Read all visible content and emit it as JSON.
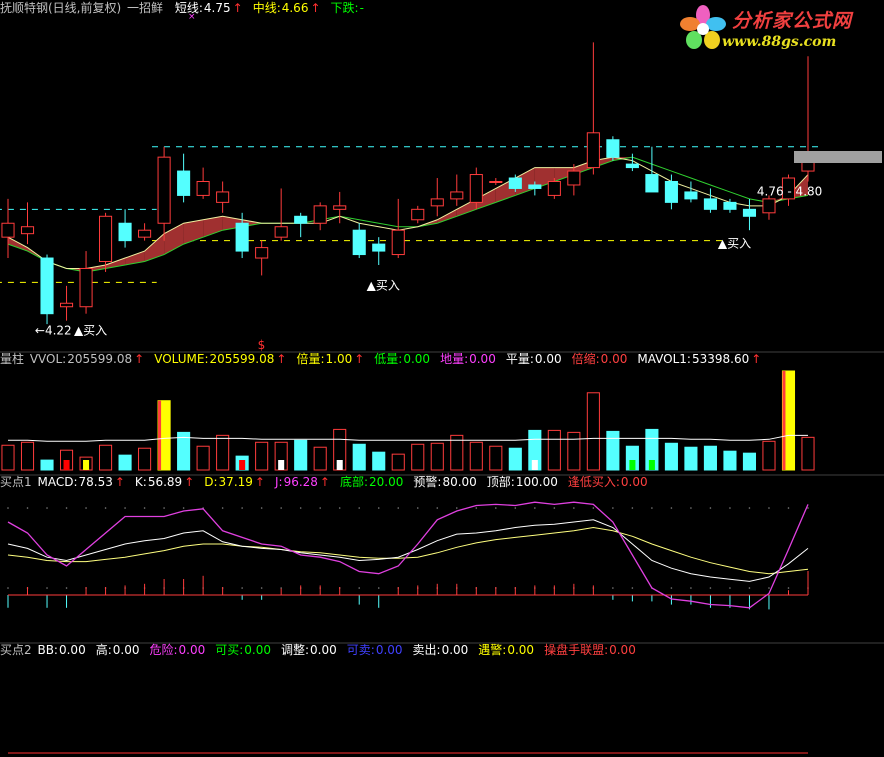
{
  "header": {
    "title": "抚顺特钢(日线,前复权)",
    "indicator_name": "一招鲜",
    "items": [
      {
        "label": "短线:",
        "value": "4.75",
        "color": "#ffffff"
      },
      {
        "label": "中线:",
        "value": "4.66",
        "color": "#ffff00"
      },
      {
        "label": "下跌:",
        "value": "-",
        "color": "#00ff00"
      }
    ],
    "marker": "×"
  },
  "logo": {
    "cn": "分析家公式网",
    "url": "www.88gs.com"
  },
  "volume_header": {
    "name": "量柱",
    "items": [
      {
        "label": "VVOL:",
        "value": "205599.08",
        "color": "#c0c0c0",
        "arrow": true
      },
      {
        "label": "VOLUME:",
        "value": "205599.08",
        "color": "#ffff00",
        "arrow": true
      },
      {
        "label": "倍量:",
        "value": "1.00",
        "color": "#ffff00",
        "arrow": true
      },
      {
        "label": "低量:",
        "value": "0.00",
        "color": "#00ff00",
        "arrow": false
      },
      {
        "label": "地量:",
        "value": "0.00",
        "color": "#ff40ff",
        "arrow": false
      },
      {
        "label": "平量:",
        "value": "0.00",
        "color": "#ffffff",
        "arrow": false
      },
      {
        "label": "倍缩:",
        "value": "0.00",
        "color": "#ff4040",
        "arrow": false
      },
      {
        "label": "MAVOL1:",
        "value": "53398.60",
        "color": "#ffffff",
        "arrow": true
      }
    ]
  },
  "macd_header": {
    "name": "买点1",
    "items": [
      {
        "label": "MACD:",
        "value": "78.53",
        "color": "#ffffff",
        "arrow": true
      },
      {
        "label": "K:",
        "value": "56.89",
        "color": "#ffffff",
        "arrow": true
      },
      {
        "label": "D:",
        "value": "37.19",
        "color": "#ffff00",
        "arrow": true
      },
      {
        "label": "J:",
        "value": "96.28",
        "color": "#ff40ff",
        "arrow": true
      },
      {
        "label": "底部:",
        "value": "20.00",
        "color": "#00ff00",
        "arrow": false
      },
      {
        "label": "预警:",
        "value": "80.00",
        "color": "#ffffff",
        "arrow": false
      },
      {
        "label": "顶部:",
        "value": "100.00",
        "color": "#ffffff",
        "arrow": false
      },
      {
        "label": "逢低买入:",
        "value": "0.00",
        "color": "#ff4040",
        "arrow": false
      }
    ]
  },
  "bb_header": {
    "name": "买点2",
    "items": [
      {
        "label": "BB:",
        "value": "0.00",
        "color": "#ffffff"
      },
      {
        "label": "高:",
        "value": "0.00",
        "color": "#ffffff"
      },
      {
        "label": "危险:",
        "value": "0.00",
        "color": "#ff40ff"
      },
      {
        "label": "可买:",
        "value": "0.00",
        "color": "#00ff00"
      },
      {
        "label": "调整:",
        "value": "0.00",
        "color": "#ffffff"
      },
      {
        "label": "可卖:",
        "value": "0.00",
        "color": "#4040ff"
      },
      {
        "label": "卖出:",
        "value": "0.00",
        "color": "#ffffff"
      },
      {
        "label": "遇警:",
        "value": "0.00",
        "color": "#ffff00"
      },
      {
        "label": "操盘手联盟:",
        "value": "0.00",
        "color": "#ff4040"
      }
    ]
  },
  "chart_data": {
    "type": "candlestick",
    "price_range": [
      4.15,
      5.09
    ],
    "candles": [
      {
        "o": 4.46,
        "h": 4.57,
        "l": 4.4,
        "c": 4.5
      },
      {
        "o": 4.47,
        "h": 4.56,
        "l": 4.44,
        "c": 4.49
      },
      {
        "o": 4.4,
        "h": 4.41,
        "l": 4.21,
        "c": 4.24
      },
      {
        "o": 4.26,
        "h": 4.32,
        "l": 4.22,
        "c": 4.27
      },
      {
        "o": 4.26,
        "h": 4.42,
        "l": 4.24,
        "c": 4.37
      },
      {
        "o": 4.39,
        "h": 4.53,
        "l": 4.36,
        "c": 4.52
      },
      {
        "o": 4.5,
        "h": 4.54,
        "l": 4.43,
        "c": 4.45
      },
      {
        "o": 4.46,
        "h": 4.5,
        "l": 4.45,
        "c": 4.48
      },
      {
        "o": 4.5,
        "h": 4.72,
        "l": 4.45,
        "c": 4.69
      },
      {
        "o": 4.65,
        "h": 4.7,
        "l": 4.56,
        "c": 4.58
      },
      {
        "o": 4.58,
        "h": 4.66,
        "l": 4.57,
        "c": 4.62
      },
      {
        "o": 4.56,
        "h": 4.62,
        "l": 4.53,
        "c": 4.59
      },
      {
        "o": 4.5,
        "h": 4.53,
        "l": 4.4,
        "c": 4.42
      },
      {
        "o": 4.4,
        "h": 4.45,
        "l": 4.35,
        "c": 4.43
      },
      {
        "o": 4.46,
        "h": 4.6,
        "l": 4.45,
        "c": 4.49
      },
      {
        "o": 4.52,
        "h": 4.53,
        "l": 4.46,
        "c": 4.5
      },
      {
        "o": 4.5,
        "h": 4.56,
        "l": 4.48,
        "c": 4.55
      },
      {
        "o": 4.54,
        "h": 4.59,
        "l": 4.5,
        "c": 4.55
      },
      {
        "o": 4.48,
        "h": 4.5,
        "l": 4.4,
        "c": 4.41
      },
      {
        "o": 4.44,
        "h": 4.46,
        "l": 4.38,
        "c": 4.42
      },
      {
        "o": 4.41,
        "h": 4.57,
        "l": 4.4,
        "c": 4.48
      },
      {
        "o": 4.51,
        "h": 4.55,
        "l": 4.5,
        "c": 4.54
      },
      {
        "o": 4.55,
        "h": 4.63,
        "l": 4.52,
        "c": 4.57
      },
      {
        "o": 4.57,
        "h": 4.64,
        "l": 4.55,
        "c": 4.59
      },
      {
        "o": 4.56,
        "h": 4.66,
        "l": 4.54,
        "c": 4.64
      },
      {
        "o": 4.62,
        "h": 4.63,
        "l": 4.61,
        "c": 4.62
      },
      {
        "o": 4.63,
        "h": 4.64,
        "l": 4.59,
        "c": 4.6
      },
      {
        "o": 4.61,
        "h": 4.62,
        "l": 4.58,
        "c": 4.6
      },
      {
        "o": 4.58,
        "h": 4.63,
        "l": 4.57,
        "c": 4.62
      },
      {
        "o": 4.61,
        "h": 4.67,
        "l": 4.58,
        "c": 4.65
      },
      {
        "o": 4.66,
        "h": 5.02,
        "l": 4.64,
        "c": 4.76
      },
      {
        "o": 4.74,
        "h": 4.75,
        "l": 4.68,
        "c": 4.69
      },
      {
        "o": 4.67,
        "h": 4.7,
        "l": 4.65,
        "c": 4.66
      },
      {
        "o": 4.64,
        "h": 4.72,
        "l": 4.6,
        "c": 4.59
      },
      {
        "o": 4.62,
        "h": 4.64,
        "l": 4.54,
        "c": 4.56
      },
      {
        "o": 4.59,
        "h": 4.62,
        "l": 4.56,
        "c": 4.57
      },
      {
        "o": 4.57,
        "h": 4.6,
        "l": 4.53,
        "c": 4.54
      },
      {
        "o": 4.56,
        "h": 4.57,
        "l": 4.53,
        "c": 4.54
      },
      {
        "o": 4.54,
        "h": 4.57,
        "l": 4.48,
        "c": 4.52
      },
      {
        "o": 4.53,
        "h": 4.58,
        "l": 4.51,
        "c": 4.57
      },
      {
        "o": 4.57,
        "h": 4.64,
        "l": 4.55,
        "c": 4.63
      },
      {
        "o": 4.65,
        "h": 4.98,
        "l": 4.62,
        "c": 4.68
      }
    ],
    "ma_short": [
      4.46,
      4.43,
      4.39,
      4.37,
      4.37,
      4.38,
      4.4,
      4.42,
      4.47,
      4.5,
      4.51,
      4.52,
      4.51,
      4.5,
      4.5,
      4.5,
      4.5,
      4.52,
      4.5,
      4.49,
      4.48,
      4.49,
      4.51,
      4.54,
      4.57,
      4.6,
      4.63,
      4.66,
      4.66,
      4.66,
      4.68,
      4.69,
      4.68,
      4.65,
      4.62,
      4.6,
      4.58,
      4.56,
      4.55,
      4.55,
      4.58,
      4.64
    ],
    "ma_mid": [
      4.44,
      4.42,
      4.39,
      4.37,
      4.36,
      4.37,
      4.38,
      4.39,
      4.41,
      4.44,
      4.46,
      4.48,
      4.49,
      4.5,
      4.5,
      4.5,
      4.51,
      4.52,
      4.51,
      4.5,
      4.49,
      4.49,
      4.5,
      4.52,
      4.54,
      4.56,
      4.58,
      4.6,
      4.62,
      4.64,
      4.66,
      4.68,
      4.69,
      4.67,
      4.65,
      4.63,
      4.61,
      4.59,
      4.57,
      4.56,
      4.57,
      4.58
    ],
    "reference_lines": [
      {
        "value": 4.72,
        "color": "#40ffff",
        "from": 8,
        "to": 41
      },
      {
        "value": 4.54,
        "color": "#40ffff",
        "from": 0,
        "to": 7
      },
      {
        "value": 4.45,
        "color": "#ffff00",
        "from": 8,
        "to": 36
      },
      {
        "value": 4.33,
        "color": "#ffff00",
        "from": 0,
        "to": 7
      }
    ],
    "annotations": [
      {
        "text": "▲买入",
        "i": 4,
        "price": 4.22
      },
      {
        "text": "▲买入",
        "i": 19,
        "price": 4.35
      },
      {
        "text": "▲买入",
        "i": 37,
        "price": 4.47
      },
      {
        "text": "←4.22",
        "i": 2,
        "price": 4.22
      },
      {
        "text": "4.76 - 4.80",
        "i": 39,
        "price": 4.62
      }
    ],
    "marker_s": {
      "text": "$",
      "i": 13
    },
    "volume": [
      0.25,
      0.28,
      0.1,
      0.2,
      0.13,
      0.25,
      0.15,
      0.22,
      0.7,
      0.38,
      0.24,
      0.35,
      0.14,
      0.28,
      0.28,
      0.3,
      0.23,
      0.41,
      0.26,
      0.18,
      0.16,
      0.26,
      0.27,
      0.35,
      0.28,
      0.24,
      0.22,
      0.4,
      0.4,
      0.38,
      0.78,
      0.39,
      0.24,
      0.41,
      0.27,
      0.23,
      0.24,
      0.19,
      0.17,
      0.29,
      1.0,
      0.33
    ],
    "volume_max": 205599.08,
    "mavol": [
      0.3,
      0.3,
      0.29,
      0.29,
      0.29,
      0.3,
      0.3,
      0.3,
      0.32,
      0.33,
      0.32,
      0.32,
      0.32,
      0.31,
      0.31,
      0.31,
      0.31,
      0.31,
      0.3,
      0.3,
      0.3,
      0.3,
      0.3,
      0.3,
      0.3,
      0.3,
      0.3,
      0.31,
      0.31,
      0.31,
      0.32,
      0.32,
      0.32,
      0.32,
      0.32,
      0.31,
      0.31,
      0.3,
      0.3,
      0.31,
      0.35,
      0.35
    ],
    "kdj": {
      "k": [
        60,
        56,
        48,
        45,
        50,
        55,
        60,
        63,
        65,
        70,
        72,
        62,
        58,
        56,
        55,
        52,
        50,
        48,
        45,
        46,
        48,
        55,
        63,
        69,
        70,
        72,
        75,
        77,
        78,
        80,
        82,
        75,
        60,
        45,
        38,
        33,
        30,
        28,
        26,
        30,
        42,
        56
      ],
      "d": [
        50,
        48,
        45,
        44,
        44,
        46,
        48,
        51,
        54,
        58,
        60,
        60,
        58,
        57,
        55,
        53,
        52,
        50,
        48,
        47,
        47,
        48,
        52,
        57,
        61,
        64,
        66,
        68,
        70,
        72,
        75,
        72,
        67,
        60,
        54,
        48,
        43,
        39,
        35,
        33,
        35,
        37
      ],
      "j": [
        80,
        70,
        50,
        40,
        55,
        70,
        85,
        85,
        85,
        90,
        92,
        72,
        66,
        60,
        58,
        50,
        48,
        44,
        35,
        33,
        40,
        60,
        82,
        90,
        95,
        96,
        95,
        98,
        96,
        98,
        96,
        80,
        50,
        20,
        10,
        8,
        5,
        4,
        2,
        15,
        55,
        96
      ]
    },
    "macd_hist": [
      -8,
      5,
      -8,
      -8,
      5,
      5,
      6,
      7,
      10,
      10,
      12,
      5,
      -3,
      -3,
      4,
      6,
      6,
      5,
      -6,
      -8,
      5,
      6,
      7,
      7,
      5,
      5,
      5,
      6,
      6,
      7,
      6,
      -3,
      -4,
      -4,
      -6,
      -6,
      -8,
      -8,
      -9,
      -9,
      3,
      15
    ],
    "bb_line": 0.0
  }
}
